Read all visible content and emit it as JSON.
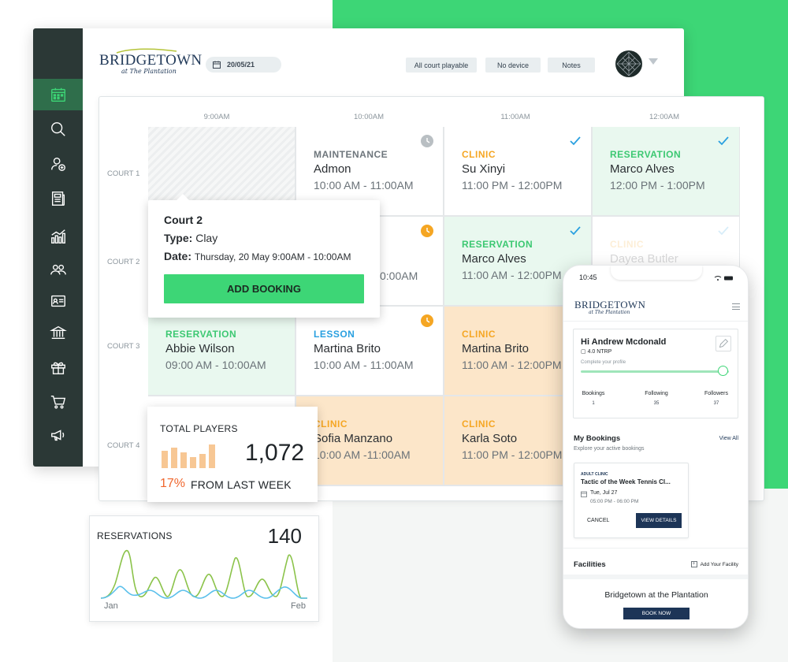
{
  "brand": {
    "name": "BRIDGETOWN",
    "tagline": "at The Plantation"
  },
  "toolbar": {
    "date": "20/05/21",
    "buttons": [
      "All court playable",
      "No device",
      "Notes"
    ]
  },
  "schedule": {
    "times": [
      "9:00AM",
      "10:00AM",
      "11:00AM",
      "12:00AM"
    ],
    "courts": [
      "COURT 1",
      "COURT 2",
      "COURT 3",
      "COURT 4"
    ],
    "cells": {
      "r1c2": {
        "type": "MAINTENANCE",
        "name": "Admon",
        "time": "10:00 AM - 11:00AM"
      },
      "r1c3": {
        "type": "CLINIC",
        "name": "Su Xinyi",
        "time": "11:00 PM - 12:00PM"
      },
      "r1c4": {
        "type": "RESERVATION",
        "name": "Marco Alves",
        "time": "12:00 PM - 1:00PM"
      },
      "r2c2": {
        "name_tail": "ega",
        "time_tail": "0:00AM"
      },
      "r2c3": {
        "type": "RESERVATION",
        "name": "Marco Alves",
        "time": "11:00 AM - 12:00PM"
      },
      "r2c4": {
        "type": "CLINIC",
        "name": "Dayea Butler"
      },
      "r3c1": {
        "type": "RESERVATION",
        "name": "Abbie Wilson",
        "time": "09:00 AM - 10:00AM"
      },
      "r3c2": {
        "type": "LESSON",
        "name": "Martina Brito",
        "time": "10:00 AM - 11:00AM"
      },
      "r3c3": {
        "type": "CLINIC",
        "name": "Martina Brito",
        "time": "11:00 AM - 12:00PM"
      },
      "r4c2": {
        "type": "CLINIC",
        "name": "Sofia Manzano",
        "time": "10:00 AM -11:00AM"
      },
      "r4c3": {
        "type": "CLINIC",
        "name": "Karla Soto",
        "time": "11:00 PM - 12:00PM"
      }
    }
  },
  "tooltip": {
    "title": "Court 2",
    "type_label": "Type:",
    "type_value": "Clay",
    "date_label": "Date:",
    "date_value": "Thursday, 20 May 9:00AM - 10:00AM",
    "button": "ADD BOOKING"
  },
  "players_card": {
    "title": "TOTAL PLAYERS",
    "value": "1,072",
    "change": "17%",
    "change_label": "FROM LAST WEEK"
  },
  "reservations_card": {
    "title": "RESERVATIONS",
    "value": "140",
    "x_start": "Jan",
    "x_end": "Feb"
  },
  "phone": {
    "time": "10:45",
    "greeting": "Hi Andrew Mcdonald",
    "ntrp": "4.0 NTRP",
    "complete_profile": "Complete your profile",
    "stats": [
      {
        "label": "Bookings",
        "value": "1"
      },
      {
        "label": "Following",
        "value": "35"
      },
      {
        "label": "Followers",
        "value": "37"
      }
    ],
    "bookings_title": "My Bookings",
    "view_all": "View All",
    "bookings_sub": "Explore your active bookings",
    "booking": {
      "tag": "ADULT CLINIC",
      "title": "Tactic of the Week Tennis Cl...",
      "date": "Tue, Jul 27",
      "time": "05:00 PM - 06:00 PM",
      "cancel": "CANCEL",
      "view": "VIEW DETAILS"
    },
    "facilities_title": "Facilities",
    "add_facility": "Add Your Facility",
    "facility_name": "Bridgetown at the Plantation",
    "book_now": "BOOK NOW"
  },
  "colors": {
    "green": "#3dd676",
    "sidebar": "#2b3836",
    "clinic_orange": "#f5a623",
    "reservation_green": "#3cc872",
    "navy": "#1d3557"
  }
}
